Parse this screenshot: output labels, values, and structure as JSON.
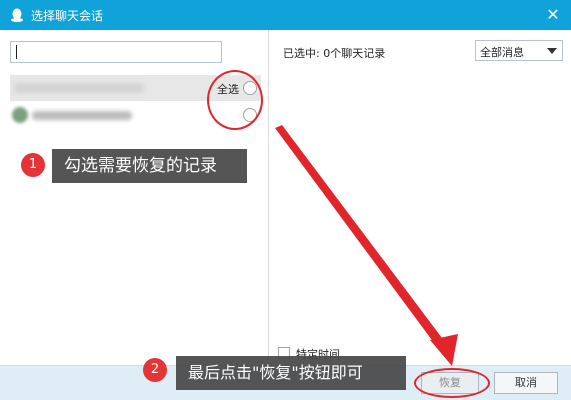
{
  "window": {
    "title": "选择聊天会话",
    "close_glyph": "✕"
  },
  "left": {
    "search": {
      "value": "",
      "placeholder": ""
    },
    "select_all_label": "全选"
  },
  "right": {
    "selected_count": "已选中: 0个聊天记录",
    "filter": {
      "selected": "全部消息"
    },
    "time_label": "特定时间"
  },
  "annotations": {
    "step1": {
      "number": "1",
      "text": "勾选需要恢复的记录"
    },
    "step2": {
      "number": "2",
      "text": "最后点击\"恢复\"按钮即可"
    }
  },
  "footer": {
    "restore_label": "恢复",
    "cancel_label": "取消"
  },
  "colors": {
    "titlebar": "#0fa3d9",
    "annotation_red": "#e0262b",
    "callout_bg": "#464646"
  }
}
